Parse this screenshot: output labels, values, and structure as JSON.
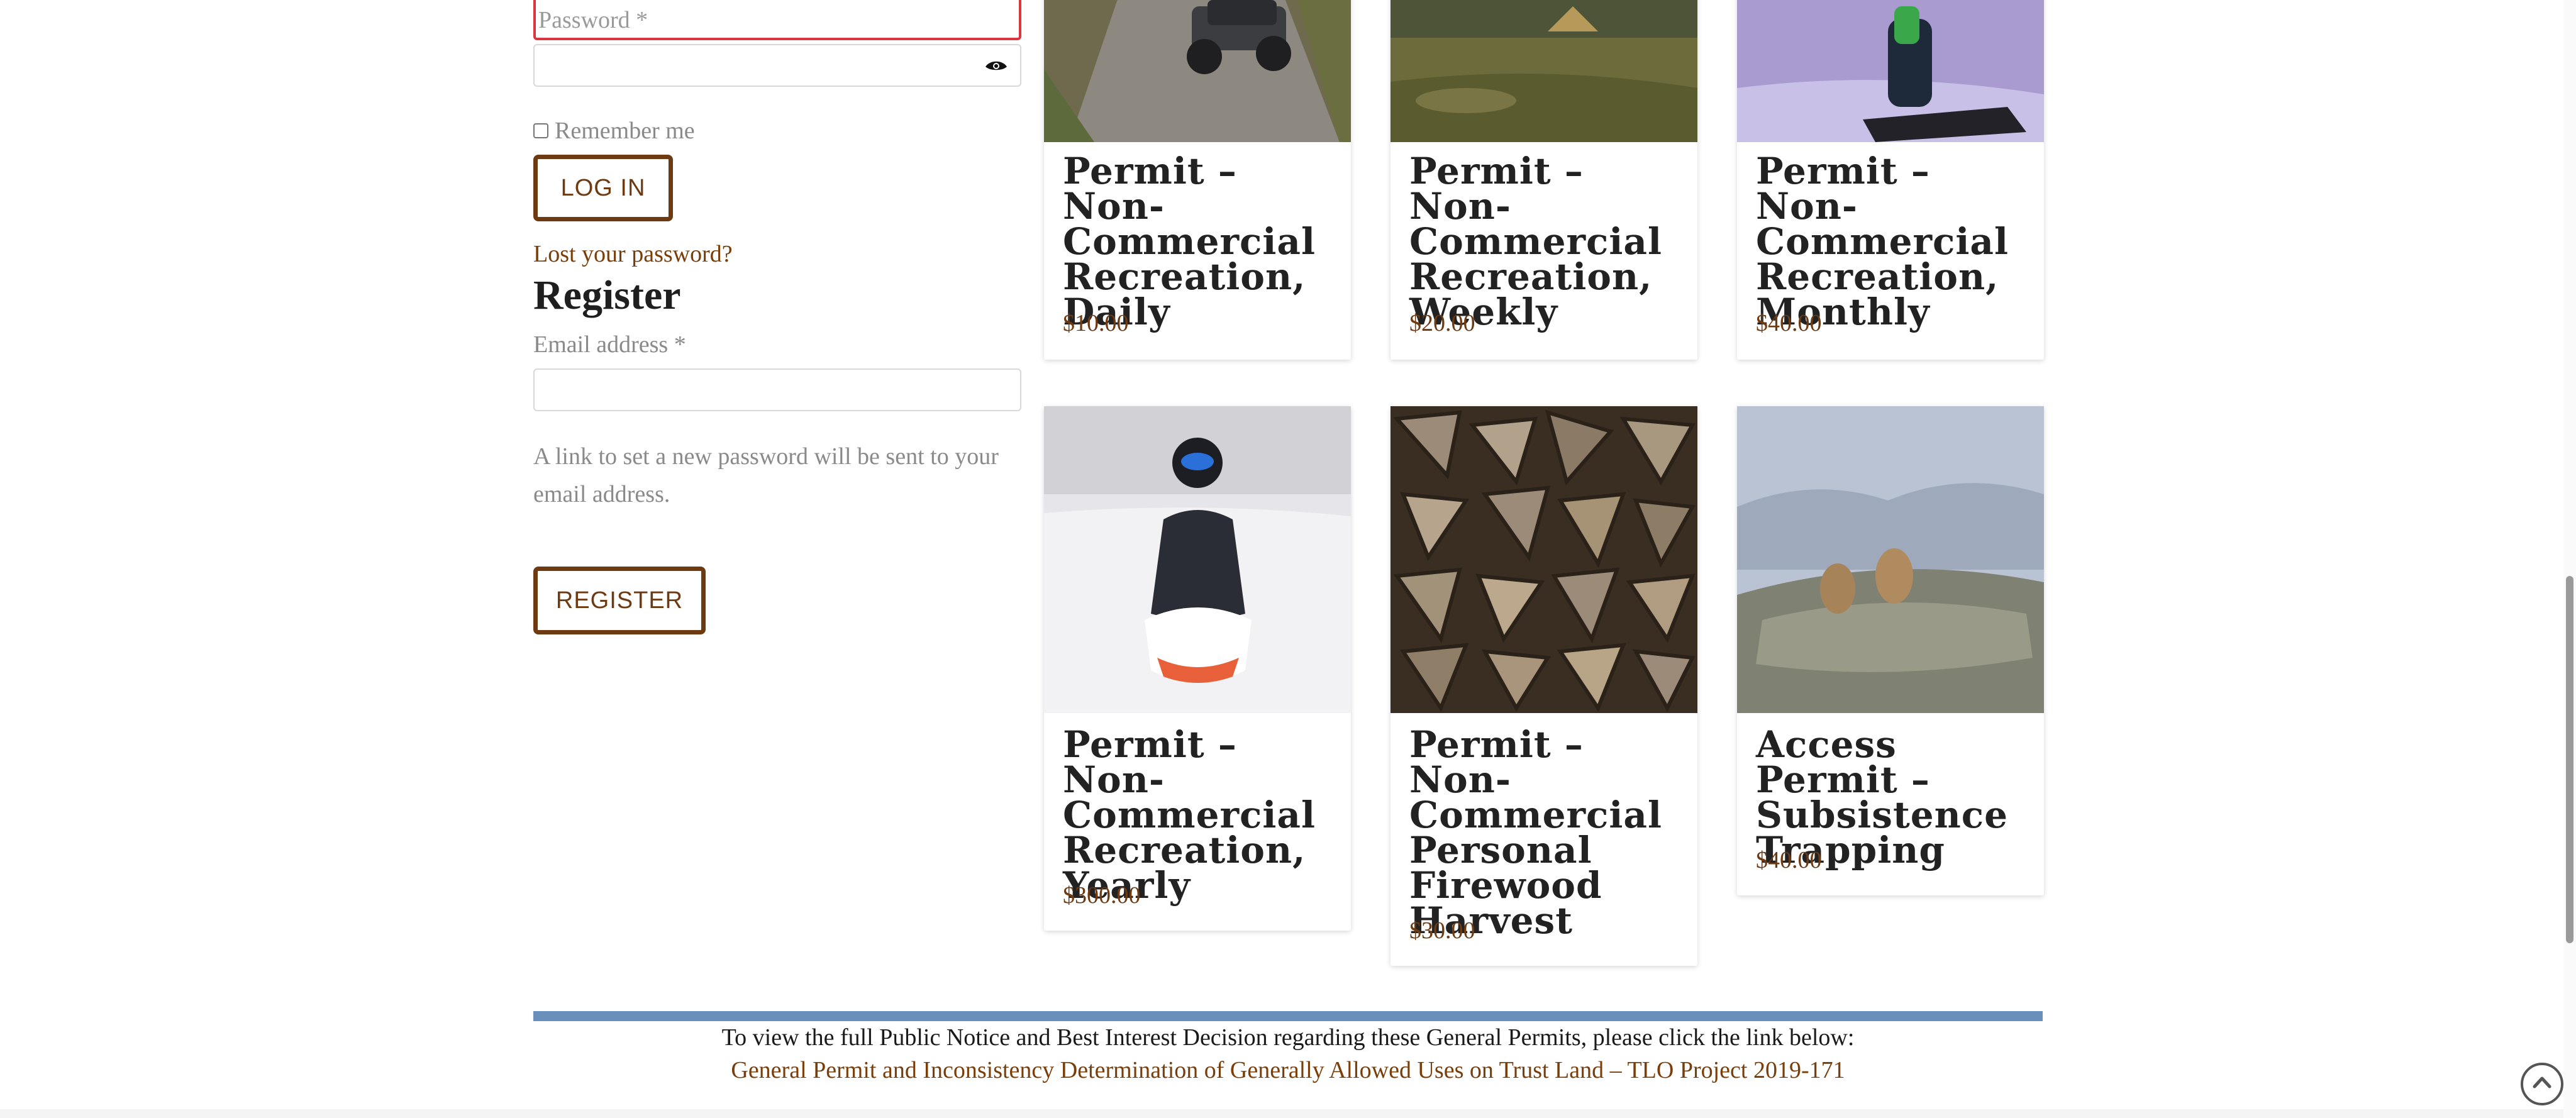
{
  "login": {
    "password_placeholder": "Password *",
    "remember_label": "Remember me",
    "login_button": "LOG IN",
    "lost_password_link": "Lost your password?"
  },
  "register": {
    "heading": "Register",
    "email_label": "Email address *",
    "note": "A link to set a new password will be sent to your email address.",
    "register_button": "REGISTER"
  },
  "products": [
    {
      "title": "Permit – Non-Commercial Recreation, Daily",
      "price": "$10.00",
      "image": "atv-on-gravel-road"
    },
    {
      "title": "Permit – Non-Commercial Recreation, Weekly",
      "price": "$20.00",
      "image": "campsite-meadow"
    },
    {
      "title": "Permit – Non-Commercial Recreation, Monthly",
      "price": "$40.00",
      "image": "snowmobile-dusk"
    },
    {
      "title": "Permit – Non-Commercial Recreation, Yearly",
      "price": "$300.00",
      "image": "snowmobile-rider-snow"
    },
    {
      "title": "Permit – Non-Commercial Personal Firewood Harvest",
      "price": "$30.00",
      "image": "stacked-firewood"
    },
    {
      "title": "Access Permit – Subsistence Trapping",
      "price": "$40.00",
      "image": "marmots-on-rock"
    }
  ],
  "notice": {
    "text": "To view the full Public Notice and Best Interest Decision regarding these General Permits, please click the link below:",
    "link": "General Permit and Inconsistency Determination of Generally Allowed Uses on Trust Land – TLO Project 2019-171"
  },
  "colors": {
    "accent": "#6e3a12",
    "error_border": "#d9363e",
    "notice_bar": "#6b8fbc"
  },
  "icons": {
    "password_toggle": "eye-icon",
    "back_to_top": "chevron-up-icon"
  }
}
